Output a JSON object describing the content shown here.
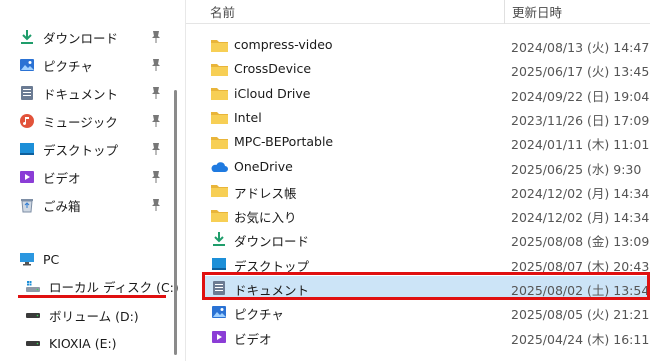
{
  "sidebar": {
    "quick_access": [
      {
        "label": "ダウンロード",
        "icon": "download-icon"
      },
      {
        "label": "ピクチャ",
        "icon": "pictures-icon"
      },
      {
        "label": "ドキュメント",
        "icon": "documents-icon"
      },
      {
        "label": "ミュージック",
        "icon": "music-icon"
      },
      {
        "label": "デスクトップ",
        "icon": "desktop-icon"
      },
      {
        "label": "ビデオ",
        "icon": "videos-icon"
      },
      {
        "label": "ごみ箱",
        "icon": "recycle-bin-icon"
      }
    ],
    "pc": {
      "label": "PC",
      "icon": "pc-icon"
    },
    "drives": [
      {
        "label": "ローカル ディスク (C:)",
        "icon": "local-disk-icon"
      },
      {
        "label": "ボリューム (D:)",
        "icon": "drive-icon"
      },
      {
        "label": "KIOXIA (E:)",
        "icon": "drive-icon"
      }
    ]
  },
  "file_list": {
    "columns": {
      "name": "名前",
      "date": "更新日時"
    },
    "rows": [
      {
        "name": "compress-video",
        "date": "2024/08/13 (火) 14:47",
        "icon": "folder-icon"
      },
      {
        "name": "CrossDevice",
        "date": "2025/06/17 (火) 13:45",
        "icon": "folder-icon"
      },
      {
        "name": "iCloud Drive",
        "date": "2024/09/22 (日) 19:04",
        "icon": "folder-icon"
      },
      {
        "name": "Intel",
        "date": "2023/11/26 (日) 17:09",
        "icon": "folder-icon"
      },
      {
        "name": "MPC-BEPortable",
        "date": "2024/01/11 (木) 11:01",
        "icon": "folder-icon"
      },
      {
        "name": "OneDrive",
        "date": "2025/06/25 (水) 9:30",
        "icon": "onedrive-icon"
      },
      {
        "name": "アドレス帳",
        "date": "2024/12/02 (月) 14:34",
        "icon": "folder-icon"
      },
      {
        "name": "お気に入り",
        "date": "2024/12/02 (月) 14:34",
        "icon": "folder-icon"
      },
      {
        "name": "ダウンロード",
        "date": "2025/08/08 (金) 13:09",
        "icon": "download-icon"
      },
      {
        "name": "デスクトップ",
        "date": "2025/08/07 (木) 20:43",
        "icon": "desktop-icon"
      },
      {
        "name": "ドキュメント",
        "date": "2025/08/02 (土) 13:54",
        "icon": "documents-icon"
      },
      {
        "name": "ピクチャ",
        "date": "2025/08/05 (火) 21:21",
        "icon": "pictures-icon"
      },
      {
        "name": "ビデオ",
        "date": "2025/04/24 (木) 16:11",
        "icon": "videos-icon"
      }
    ]
  },
  "colors": {
    "accent": "#e01010",
    "folder": "#f4c542",
    "selection": "#cce4f7"
  }
}
